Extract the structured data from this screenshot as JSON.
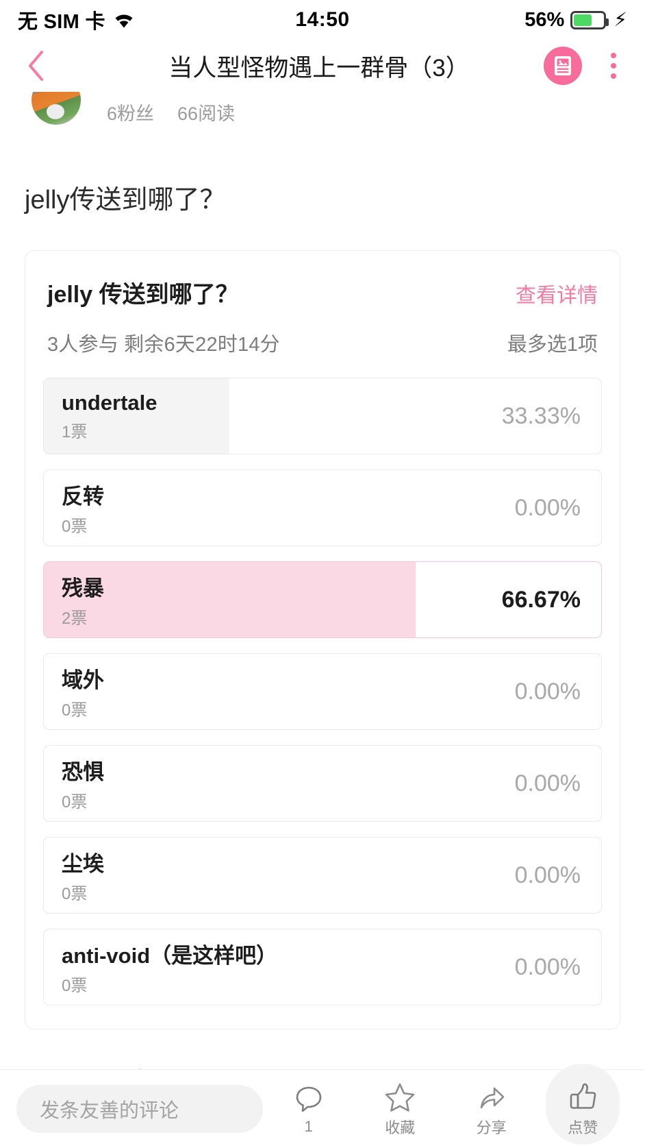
{
  "statusbar": {
    "carrier": "无 SIM 卡",
    "wifi_icon": "wifi-icon",
    "time": "14:50",
    "battery_percent": "56%",
    "battery_level": 56,
    "charging_icon": "lightning-bolt-icon"
  },
  "navbar": {
    "back_icon": "back-chevron-icon",
    "title": "当人型怪物遇上一群骨（3）",
    "article_icon": "article-image-icon",
    "more_icon": "more-dots-icon"
  },
  "author": {
    "avatar": "user-avatar",
    "followers": "6粉丝",
    "reads": "66阅读"
  },
  "post": {
    "question": "jelly传送到哪了？"
  },
  "poll": {
    "title": "jelly 传送到哪了？",
    "detail_link": "查看详情",
    "participants": "3人参与 剩余6天22时14分",
    "max_choice": "最多选1项",
    "options": [
      {
        "label": "undertale",
        "votes": "1票",
        "percent": "33.33%",
        "fill": 33.33,
        "selected": false
      },
      {
        "label": "反转",
        "votes": "0票",
        "percent": "0.00%",
        "fill": 0,
        "selected": false
      },
      {
        "label": "残暴",
        "votes": "2票",
        "percent": "66.67%",
        "fill": 66.67,
        "selected": true
      },
      {
        "label": "域外",
        "votes": "0票",
        "percent": "0.00%",
        "fill": 0,
        "selected": false
      },
      {
        "label": "恐惧",
        "votes": "0票",
        "percent": "0.00%",
        "fill": 0,
        "selected": false
      },
      {
        "label": "尘埃",
        "votes": "0票",
        "percent": "0.00%",
        "fill": 0,
        "selected": false
      },
      {
        "label": "anti-void（是这样吧）",
        "votes": "0票",
        "percent": "0.00%",
        "fill": 0,
        "selected": false
      }
    ]
  },
  "tail": {
    "text": "秃了个白awa"
  },
  "bottombar": {
    "comment_placeholder": "发条友善的评论",
    "comment_count": "1",
    "favorite_label": "收藏",
    "share_label": "分享",
    "like_label": "点赞"
  },
  "colors": {
    "accent_pink": "#f97a9f",
    "selected_fill": "#fbd9e4",
    "neutral_fill": "#f4f4f4",
    "battery_green": "#4cd964"
  }
}
